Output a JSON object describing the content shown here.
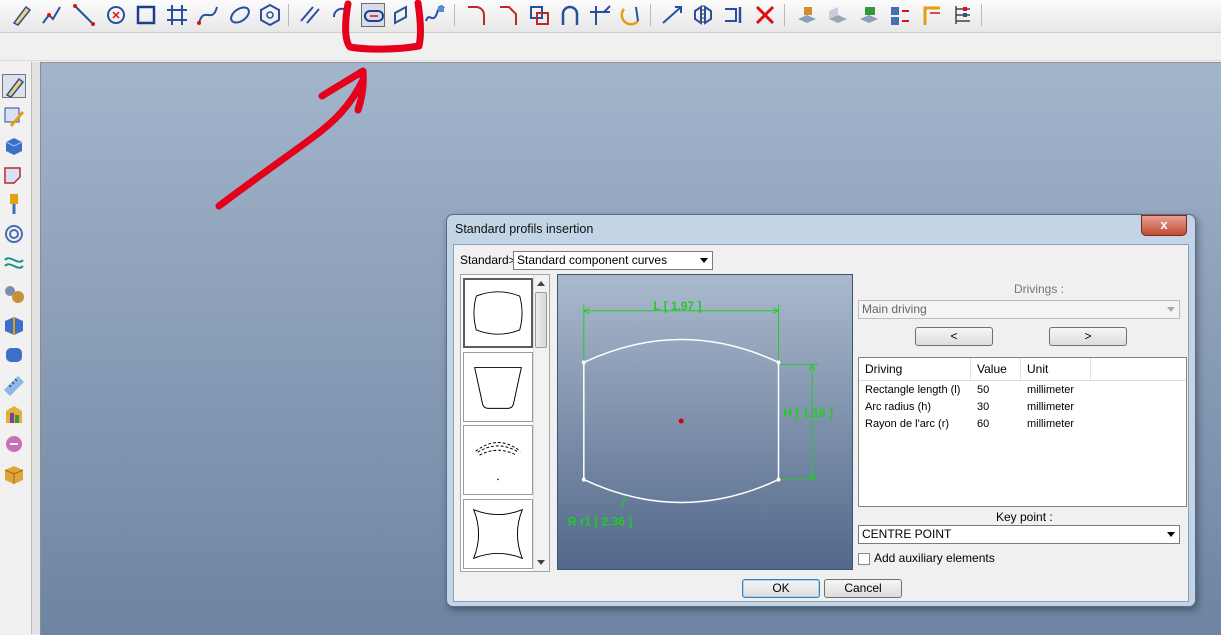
{
  "toolbar": {
    "icons": [
      "pencil-sketch",
      "polyline",
      "line",
      "circle-center",
      "rectangle",
      "grid-lines",
      "spline",
      "ellipse",
      "polygon",
      "parallel-lines",
      "arc",
      "standard-profile-insertion",
      "parallelogram",
      "wave-curve",
      "fillet",
      "chamfer",
      "boolean-squares",
      "arch-profile",
      "trim",
      "rotate-arc",
      "dimension",
      "symmetry",
      "offset",
      "delete-cross",
      "plane-view",
      "sheet",
      "layer-stack",
      "align-part",
      "corner-tool",
      "manage-entities"
    ],
    "active_index": 11
  },
  "left_toolbar": {
    "icons": [
      "sketch-pencil",
      "pencil-edit",
      "solid-cube",
      "sheet-metal",
      "pin",
      "rings",
      "coil-spring",
      "gears",
      "folded-plate",
      "rounded-cube",
      "ruler",
      "colors",
      "cam-tool",
      "assembly-box"
    ],
    "active_index": 0
  },
  "annotation": {
    "color": "#e5001b"
  },
  "dialog": {
    "title": "Standard profils insertion",
    "close_label": "x",
    "standard_label": "Standard",
    "standard_arrow": ">",
    "standard_value": "Standard component curves",
    "drivings_label": "Drivings :",
    "drivings_value": "Main driving",
    "prev_label": "<",
    "next_label": ">",
    "grid": {
      "columns": [
        "Driving",
        "Value",
        "Unit"
      ],
      "rows": [
        {
          "driving": "Rectangle length (l)",
          "value": "50",
          "unit": "millimeter"
        },
        {
          "driving": "Arc radius (h)",
          "value": "30",
          "unit": "millimeter"
        },
        {
          "driving": "Rayon de l'arc (r)",
          "value": "60",
          "unit": "millimeter"
        }
      ]
    },
    "key_point_label": "Key point :",
    "key_point_value": "CENTRE POINT",
    "aux_label": "Add auxiliary elements",
    "aux_checked": false,
    "ok_label": "OK",
    "cancel_label": "Cancel",
    "thumbnails": [
      "barrel-profile",
      "trapezoid-profile",
      "arc-slot-profile",
      "concave-square-profile"
    ],
    "preview": {
      "dim_top": "L [ 1.97 ]",
      "dim_right": "H [ 1.18 ]",
      "dim_radius": "R r1 [ 2.36 ]",
      "dim_color": "#22cc22",
      "profile_color": "#ffffff",
      "center_color": "#dd0000"
    }
  }
}
